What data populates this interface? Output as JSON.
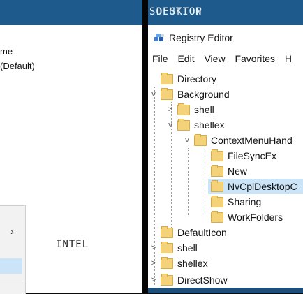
{
  "banner": {
    "left_title": "DESKTOP",
    "right_title": "SOLUTION"
  },
  "left_panel": {
    "col_text1": "me",
    "col_text2": "(Default)",
    "context_chevron": "›",
    "intel_label": "INTEL"
  },
  "registry": {
    "title": "Registry Editor",
    "menu": [
      "File",
      "Edit",
      "View",
      "Favorites",
      "H"
    ],
    "tree": [
      {
        "label": "Directory"
      },
      {
        "label": "Background"
      },
      {
        "label": "shell"
      },
      {
        "label": "shellex"
      },
      {
        "label": "ContextMenuHand"
      },
      {
        "label": "FileSyncEx"
      },
      {
        "label": "New"
      },
      {
        "label": "NvCplDesktopC"
      },
      {
        "label": "Sharing"
      },
      {
        "label": "WorkFolders"
      },
      {
        "label": "DefaultIcon"
      },
      {
        "label": "shell"
      },
      {
        "label": "shellex"
      },
      {
        "label": "DirectShow"
      }
    ]
  },
  "icons": {
    "registry": "registry-editor-icon",
    "folder": "folder-icon",
    "expand": "chevron-right-icon",
    "collapse": "chevron-down-icon"
  },
  "colors": {
    "banner": "#1e5a8c",
    "folder": "#f4d27a",
    "selection": "#cce4f7"
  }
}
